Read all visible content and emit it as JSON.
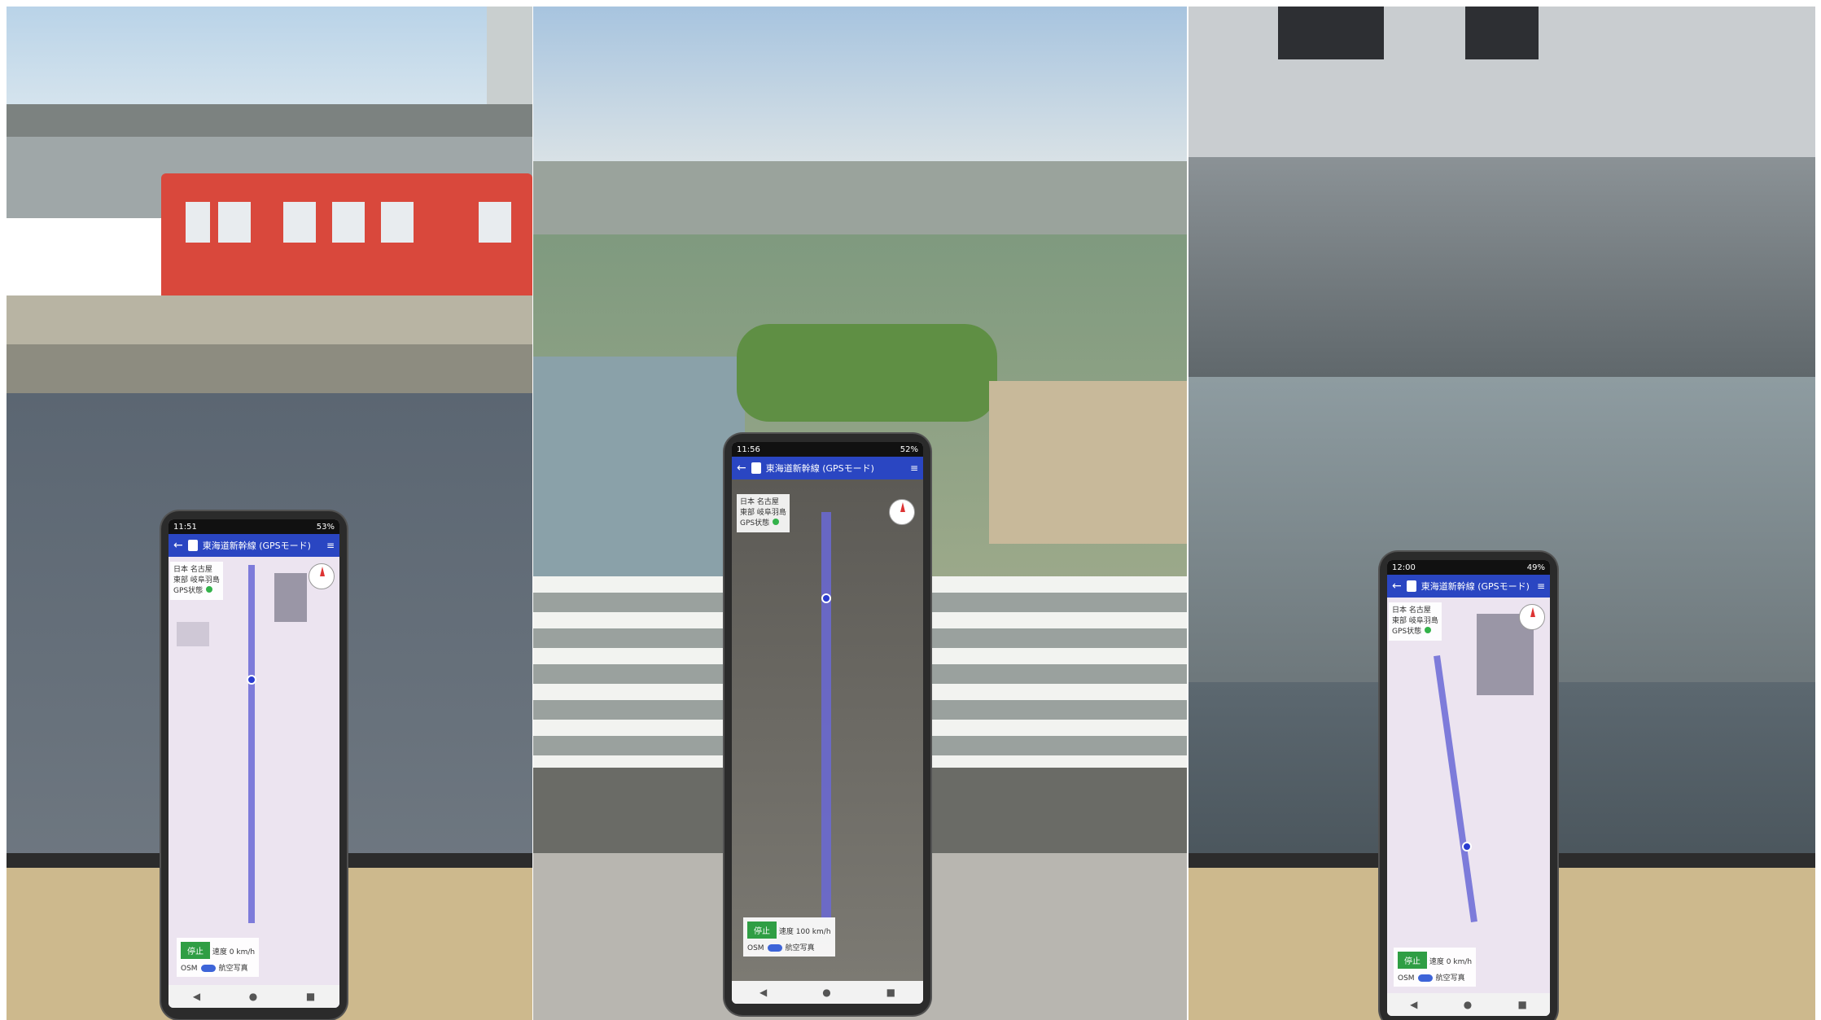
{
  "app": {
    "title": "東海道新幹線 (GPSモード)",
    "info": {
      "line1_label": "日本",
      "line1_value": "名古屋",
      "line2_label": "東部",
      "line2_value": "岐阜羽島",
      "gps_label": "GPS状態"
    },
    "controls": {
      "stop_label": "停止",
      "speed_label": "速度",
      "osm_label": "OSM",
      "photo_label": "航空写真"
    }
  },
  "panels": [
    {
      "name": "station-platform",
      "time": "11:51",
      "battery": "53%",
      "speed_value": "0 km/h"
    },
    {
      "name": "rice-fields",
      "time": "11:56",
      "battery": "52%",
      "speed_value": "100 km/h"
    },
    {
      "name": "station-arrival",
      "time": "12:00",
      "battery": "49%",
      "speed_value": "0 km/h"
    }
  ],
  "colors": {
    "appbar": "#2a46c2",
    "route": "#6a68d6",
    "gps_ok": "#33b24a",
    "train": "#d9483c"
  },
  "icons": [
    "back-arrow-icon",
    "app-logo-icon",
    "menu-icon",
    "compass-icon",
    "position-marker-icon",
    "nav-back-icon",
    "nav-home-icon",
    "nav-recent-icon"
  ]
}
